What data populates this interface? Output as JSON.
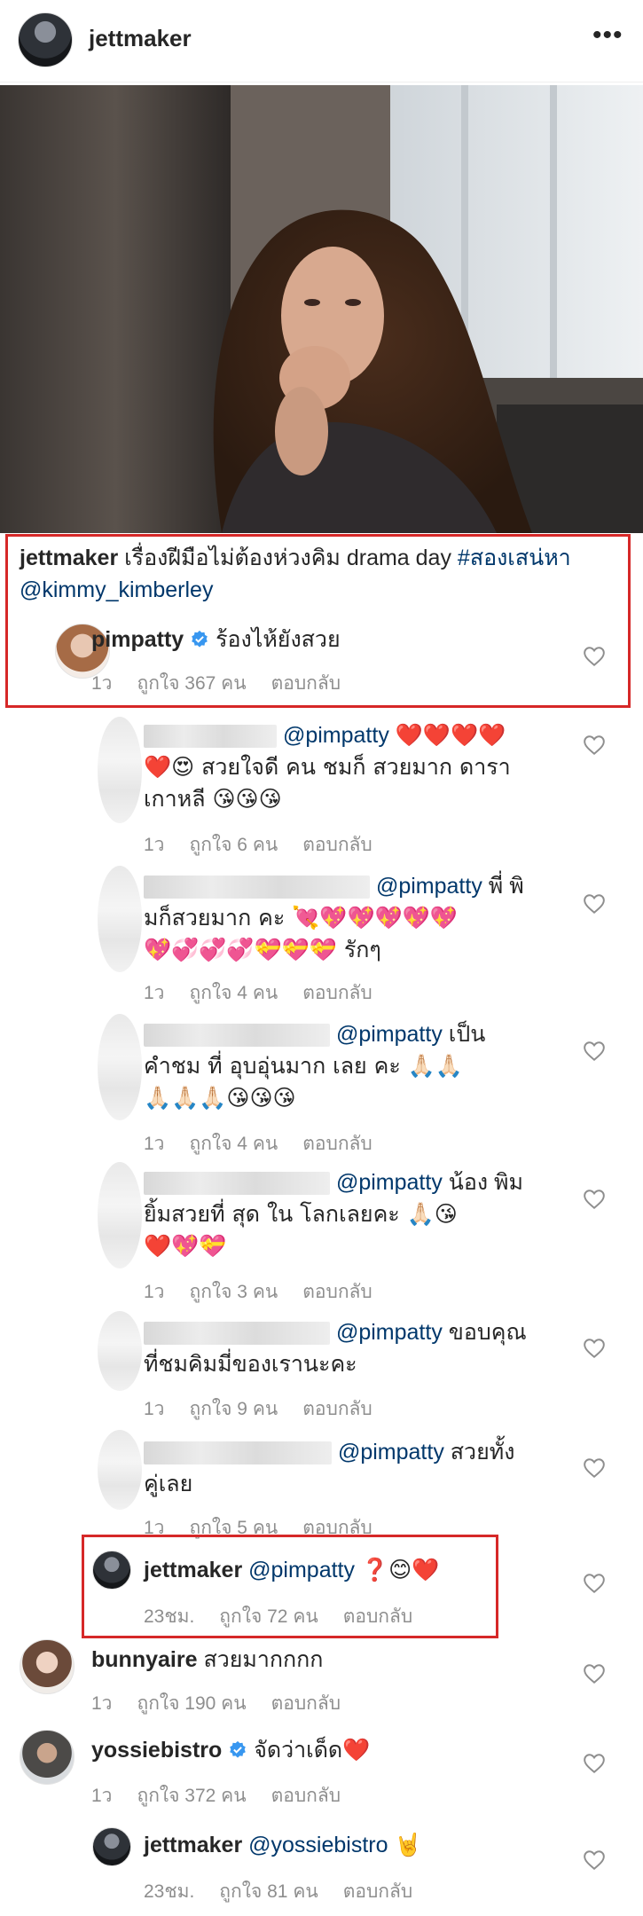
{
  "post": {
    "username": "jettmaker",
    "more_icon": "more-horizontal-icon"
  },
  "caption": {
    "username": "jettmaker",
    "text": "เรื่องฝีมือไม่ต้องห่วงคิม drama day",
    "hashtag": "#สองเสน่หา",
    "mention": "@kimmy_kimberley"
  },
  "comments": [
    {
      "username": "pimpatty",
      "verified": true,
      "text": "ร้องไห้ยังสวย",
      "time": "1ว",
      "likes": "ถูกใจ 367 คน",
      "reply": "ตอบกลับ"
    },
    {
      "mention": "@pimpatty",
      "text1": "❤️❤️❤️❤️",
      "text2": "❤️😍 สวยใจดี คน ชมก็ สวยมาก ดารา",
      "text3": "เกาหลี 😘😘😘",
      "time": "1ว",
      "likes": "ถูกใจ 6 คน",
      "reply": "ตอบกลับ"
    },
    {
      "mention": "@pimpatty",
      "text1": "พี่ พิ",
      "text2": "มก็สวยมาก คะ 💘💖💖💖💖💖",
      "text3": "💖💞💞💞💝💝💝 รักๆ",
      "time": "1ว",
      "likes": "ถูกใจ 4 คน",
      "reply": "ตอบกลับ"
    },
    {
      "mention": "@pimpatty",
      "text1": "เป็น",
      "text2": "คำชม ที่ อุบอุ่นมาก เลย คะ 🙏🏻🙏🏻",
      "text3": "🙏🏻🙏🏻🙏🏻😘😘😘",
      "time": "1ว",
      "likes": "ถูกใจ 4 คน",
      "reply": "ตอบกลับ"
    },
    {
      "mention": "@pimpatty",
      "text1": "น้อง พิม",
      "text2": "ยิ้มสวยที่ สุด ใน โลกเลยคะ 🙏🏻😘",
      "text3": "❤️💖💝",
      "time": "1ว",
      "likes": "ถูกใจ 3 คน",
      "reply": "ตอบกลับ"
    },
    {
      "mention": "@pimpatty",
      "text1": "ขอบคุณ",
      "text2": "ที่ชมคิมมี่ของเรานะคะ",
      "time": "1ว",
      "likes": "ถูกใจ 9 คน",
      "reply": "ตอบกลับ"
    },
    {
      "mention": "@pimpatty",
      "text1": "สวยทั้ง",
      "text2": "คู่เลย",
      "time": "1ว",
      "likes": "ถูกใจ 5 คน",
      "reply": "ตอบกลับ"
    },
    {
      "username": "jettmaker",
      "mention": "@pimpatty",
      "text": "❓😊❤️",
      "time": "23ชม.",
      "likes": "ถูกใจ 72 คน",
      "reply": "ตอบกลับ"
    },
    {
      "username": "bunnyaire",
      "text": "สวยมากกกก",
      "time": "1ว",
      "likes": "ถูกใจ 190 คน",
      "reply": "ตอบกลับ"
    },
    {
      "username": "yossiebistro",
      "verified": true,
      "text": "จัดว่าเด็ด❤️",
      "time": "1ว",
      "likes": "ถูกใจ 372 คน",
      "reply": "ตอบกลับ"
    },
    {
      "username": "jettmaker",
      "mention": "@yossiebistro",
      "text": "🤘",
      "time": "23ชม.",
      "likes": "ถูกใจ 81 คน",
      "reply": "ตอบกลับ"
    }
  ],
  "colors": {
    "link": "#00376b",
    "muted": "#8e8e8e",
    "highlight_box": "#d62828",
    "verified": "#3897f0"
  }
}
